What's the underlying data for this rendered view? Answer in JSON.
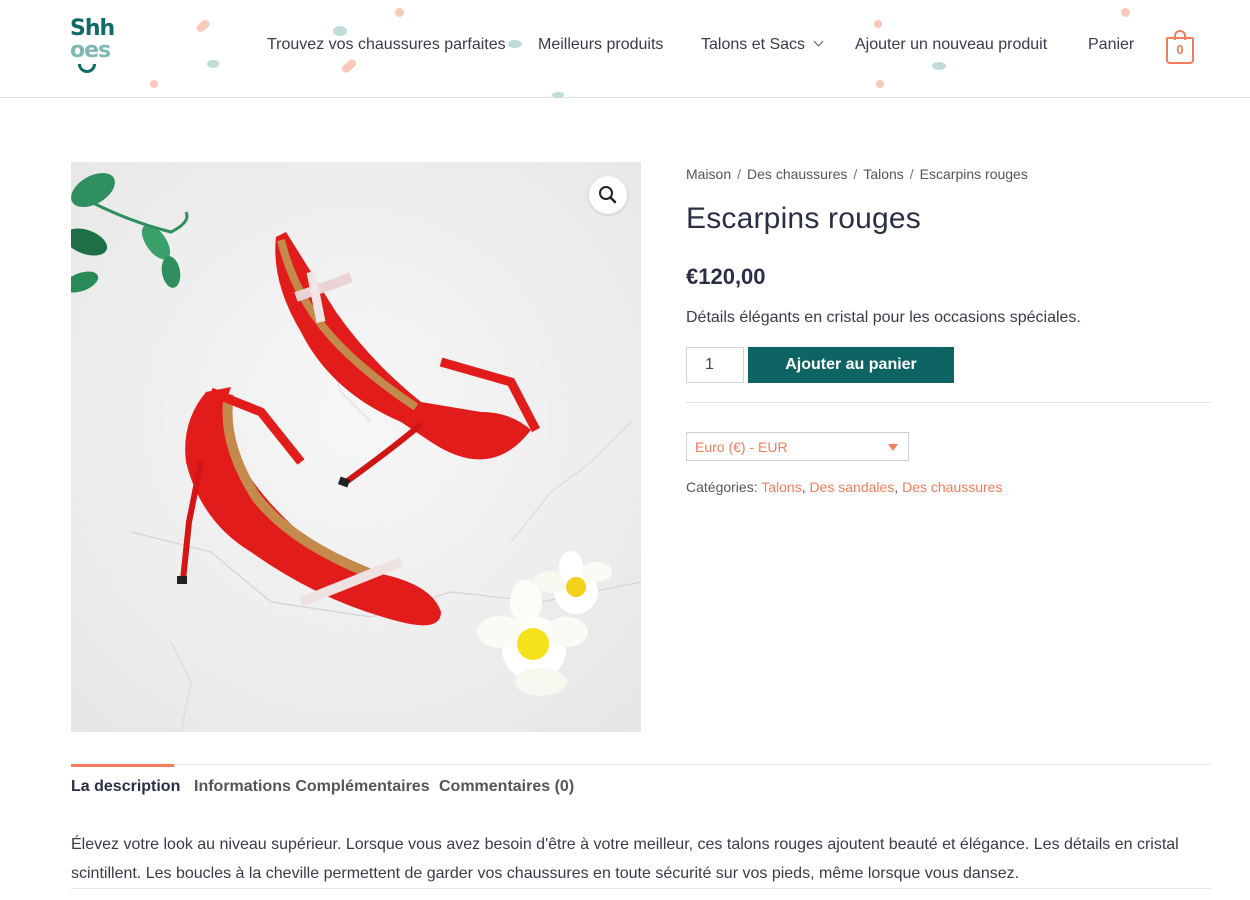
{
  "brand": {
    "logo_line1": "Shh",
    "logo_line2": "oes"
  },
  "nav": {
    "items": [
      {
        "label": "Trouvez vos chaussures parfaites"
      },
      {
        "label": "Meilleurs produits"
      },
      {
        "label": "Talons et Sacs"
      },
      {
        "label": "Ajouter un nouveau produit"
      },
      {
        "label": "Panier"
      }
    ],
    "cart_count": "0",
    "accent_color": "#f27d5a",
    "brand_color": "#0f6b67"
  },
  "breadcrumb": [
    "Maison",
    "Des chaussures",
    "Talons",
    "Escarpins rouges"
  ],
  "breadcrumb_separator": "/",
  "product": {
    "title": "Escarpins rouges",
    "price": "€120,00",
    "short_description": "Détails élégants en cristal pour les occasions spéciales.",
    "quantity": "1",
    "add_to_cart_label": "Ajouter au panier",
    "currency_selected": "Euro (€) - EUR",
    "categories_label": "Catégories:",
    "categories": [
      "Talons",
      "Des sandales",
      "Des chaussures"
    ]
  },
  "tabs": [
    {
      "label": "La description",
      "active": true
    },
    {
      "label": "Informations Complémentaires",
      "active": false
    },
    {
      "label": "Commentaires (0)",
      "active": false
    }
  ],
  "description": "Élevez votre look au niveau supérieur. Lorsque vous avez besoin d'être à votre meilleur, ces talons rouges ajoutent beauté et élégance. Les détails en cristal scintillent. Les boucles à la cheville permettent de garder vos chaussures en toute sécurité sur vos pieds, même lorsque vous dansez.",
  "icons": {
    "zoom": "magnifier-icon",
    "cart": "shopping-bag-icon",
    "dropdown": "chevron-down-icon",
    "select_arrow": "caret-down-icon"
  }
}
